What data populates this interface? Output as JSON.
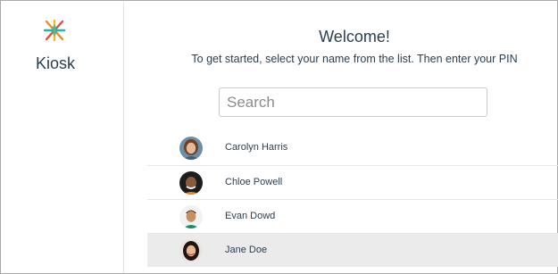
{
  "app": {
    "name": "Kiosk"
  },
  "welcome": {
    "title": "Welcome!",
    "subtitle": "To get started, select your name from the list. Then enter your PIN"
  },
  "search": {
    "placeholder": "Search",
    "value": ""
  },
  "users": [
    {
      "name": "Carolyn Harris",
      "selected": false
    },
    {
      "name": "Chloe Powell",
      "selected": false
    },
    {
      "name": "Evan Dowd",
      "selected": false
    },
    {
      "name": "Jane Doe",
      "selected": true
    }
  ],
  "colors": {
    "text": "#2b3e50",
    "selected_row": "#ebebeb",
    "logo_orange": "#f08a24",
    "logo_red": "#e84c3d",
    "logo_teal": "#1fb6b0",
    "logo_yellow": "#f5b81f"
  }
}
